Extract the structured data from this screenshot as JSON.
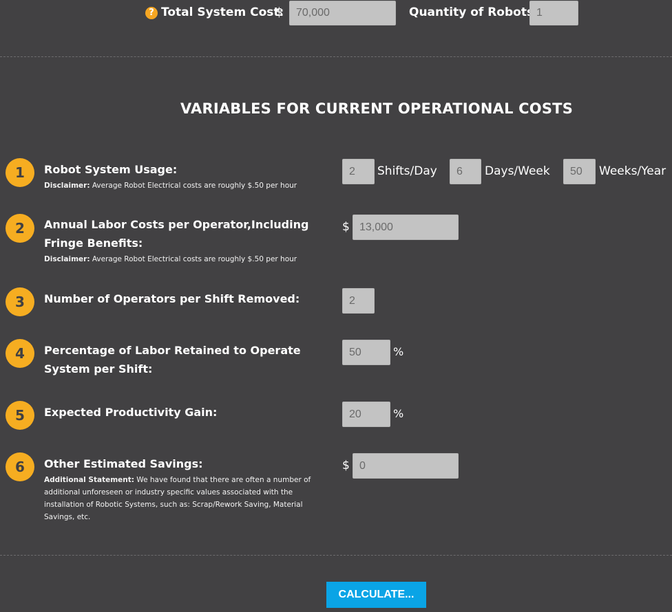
{
  "top": {
    "help_icon": "?",
    "total_cost_label": "Total System Cost:",
    "currency_symbol": "$",
    "total_cost_value": "70,000",
    "quantity_label": "Quantity of Robots:",
    "quantity_value": "1"
  },
  "section_title": "VARIABLES FOR CURRENT OPERATIONAL COSTS",
  "rows": [
    {
      "number": "1",
      "label": "Robot System Usage:",
      "note_title": "Disclaimer:",
      "note_text": " Average Robot Electrical costs are roughly $.50 per hour",
      "shifts_value": "2",
      "shifts_unit": "Shifts/Day",
      "days_value": "6",
      "days_unit": "Days/Week",
      "weeks_value": "50",
      "weeks_unit": "Weeks/Year"
    },
    {
      "number": "2",
      "label": "Annual Labor Costs per Operator,Including Fringe Benefits:",
      "note_title": "Disclaimer:",
      "note_text": " Average Robot Electrical costs are roughly $.50 per hour",
      "currency_symbol": "$",
      "value": "13,000"
    },
    {
      "number": "3",
      "label": "Number of Operators per Shift Removed:",
      "value": "2"
    },
    {
      "number": "4",
      "label": "Percentage of Labor Retained to Operate System per Shift:",
      "value": "50",
      "unit": "%"
    },
    {
      "number": "5",
      "label": "Expected Productivity Gain:",
      "value": "20",
      "unit": "%"
    },
    {
      "number": "6",
      "label": "Other Estimated Savings:",
      "note_title": "Additional Statement:",
      "note_text": " We have found that there are often a number of additional unforeseen or industry specific values associated with the installation of Robotic Systems, such as: Scrap/Rework Saving, Material Savings, etc.",
      "currency_symbol": "$",
      "value": "0"
    }
  ],
  "calculate_label": "CALCULATE..."
}
